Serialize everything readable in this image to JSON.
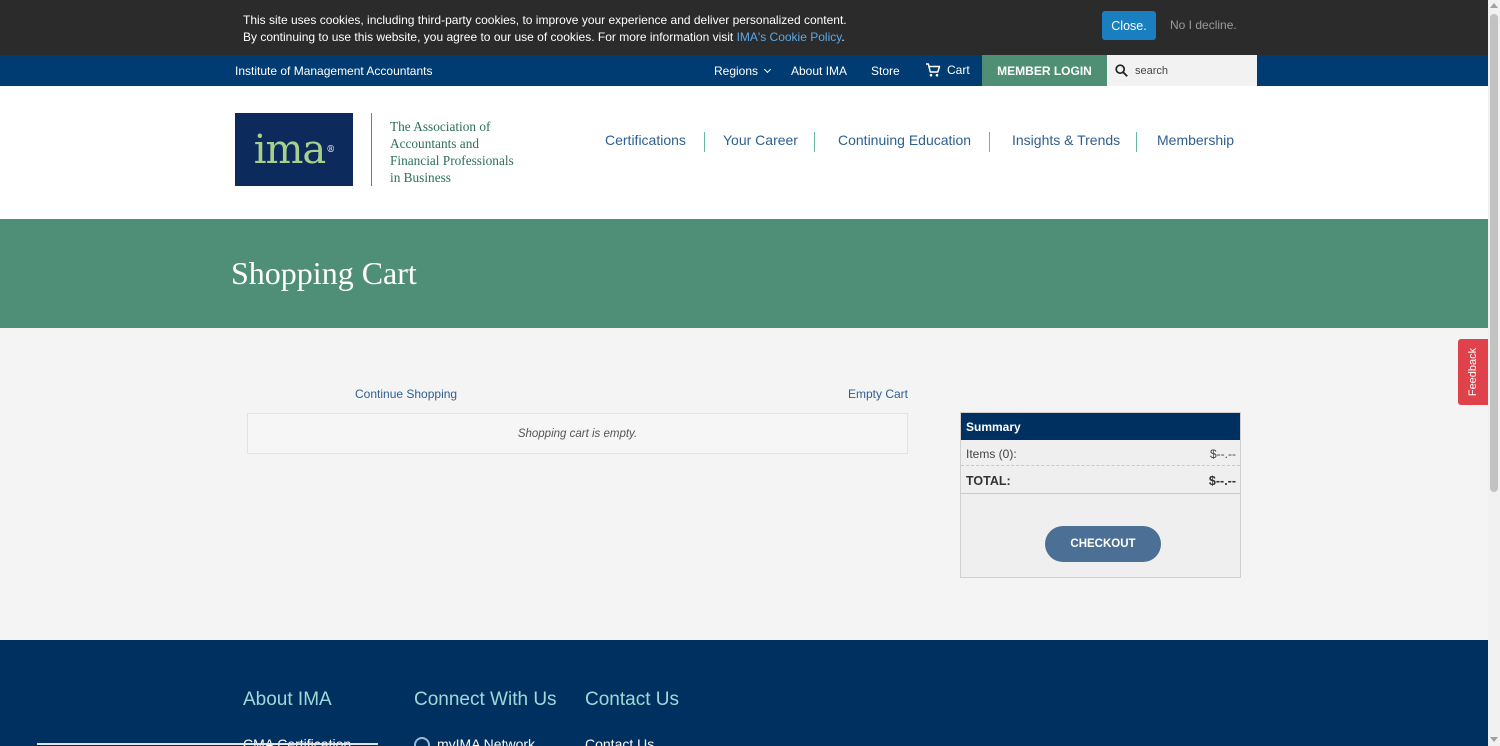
{
  "cookie_bar": {
    "line1": "This site uses cookies, including third-party cookies, to improve your experience and deliver personalized content.",
    "line2_prefix": "By continuing to use this website, you agree to our use of cookies. For more information visit ",
    "link_text": "IMA's Cookie Policy",
    "line2_suffix": ".",
    "close_label": "Close.",
    "decline_label": "No I decline."
  },
  "top_bar": {
    "org_name": "Institute of Management Accountants",
    "regions_label": "Regions",
    "about_label": "About IMA",
    "store_label": "Store",
    "cart_label": "Cart",
    "member_login_label": "MEMBER LOGIN",
    "search_placeholder": "search"
  },
  "header": {
    "logo_text": "ima",
    "logo_mark": "®",
    "tagline": [
      "The Association of",
      "Accountants and",
      "Financial Professionals",
      "in Business"
    ],
    "nav": [
      "Certifications",
      "Your Career",
      "Continuing Education",
      "Insights & Trends",
      "Membership"
    ]
  },
  "banner": {
    "title": "Shopping Cart"
  },
  "cart": {
    "continue_shopping": "Continue Shopping",
    "empty_cart": "Empty Cart",
    "empty_message": "Shopping cart is empty."
  },
  "summary": {
    "title": "Summary",
    "items_label": "Items (0):",
    "items_value": "$--.--",
    "total_label": "TOTAL:",
    "total_value": "$--.--",
    "checkout_label": "CHECKOUT"
  },
  "feedback_label": "Feedback",
  "footer": {
    "about_heading": "About IMA",
    "connect_heading": "Connect With Us",
    "contact_heading": "Contact Us",
    "about_first_link": "CMA Certification",
    "connect_first_link": "myIMA Network",
    "contact_first_link": "Contact Us"
  },
  "colors": {
    "cookie_bg": "#2b2b2b",
    "navy": "#003b71",
    "green": "#4f8f74",
    "link_blue": "#2e5f8f",
    "checkout_btn": "#4b6f95",
    "feedback": "#e0424b"
  },
  "icons": {
    "cart": "cart-icon",
    "search": "search-icon",
    "regions_caret": "chevron-down-icon",
    "network": "network-icon"
  }
}
